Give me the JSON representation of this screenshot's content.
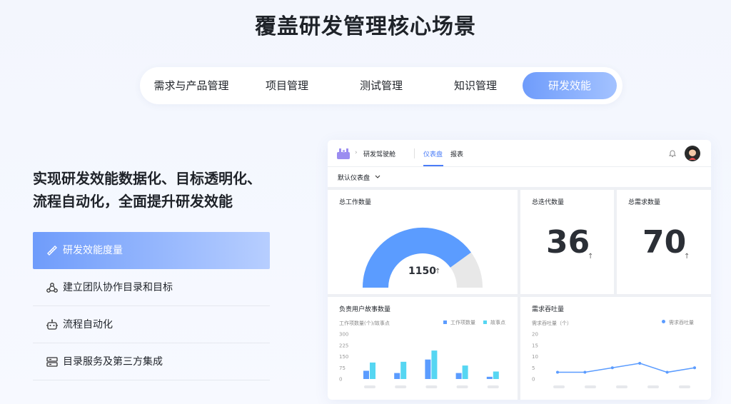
{
  "title": "覆盖研发管理核心场景",
  "tabs": [
    {
      "label": "需求与产品管理"
    },
    {
      "label": "项目管理"
    },
    {
      "label": "测试管理"
    },
    {
      "label": "知识管理"
    },
    {
      "label": "研发效能"
    }
  ],
  "headline": {
    "line1": "实现研发效能数据化、目标透明化、",
    "line2": "流程自动化，全面提升研发效能"
  },
  "features": [
    {
      "label": "研发效能度量",
      "icon": "ruler-icon"
    },
    {
      "label": "建立团队协作目录和目标",
      "icon": "team-icon"
    },
    {
      "label": "流程自动化",
      "icon": "robot-icon"
    },
    {
      "label": "目录服务及第三方集成",
      "icon": "server-icon"
    }
  ],
  "dashboard": {
    "breadcrumb": "研发驾驶舱",
    "tab_active": "仪表盘",
    "tab_other": "报表",
    "selector": "默认仪表盘",
    "card1": {
      "title": "总工作数量",
      "value": "1150",
      "gauge_fraction": 0.8
    },
    "card2": {
      "title": "总迭代数量",
      "value": "36"
    },
    "card3": {
      "title": "总需求数量",
      "value": "70"
    },
    "arrow": "↑",
    "colors": {
      "primary": "#5b9cff",
      "secondary": "#56d6f2",
      "gauge_bg": "#e8e8e8"
    }
  },
  "chart_data": [
    {
      "type": "bar",
      "title": "负责用户故事数量",
      "ylabel": "工作项数量(个)/故事点",
      "ylim": [
        0,
        300
      ],
      "yticks": [
        "300",
        "225",
        "150",
        "75",
        "0"
      ],
      "categories": [
        "",
        "",
        "",
        "",
        ""
      ],
      "series": [
        {
          "name": "工作项数量",
          "values": [
            55,
            40,
            130,
            40,
            15
          ]
        },
        {
          "name": "故事点",
          "values": [
            110,
            115,
            190,
            90,
            50
          ]
        }
      ]
    },
    {
      "type": "line",
      "title": "需求吞吐量",
      "ylabel": "需求吞吐量（个）",
      "ylim": [
        0,
        20
      ],
      "yticks": [
        "20",
        "15",
        "10",
        "5",
        "0"
      ],
      "categories": [
        "",
        "",
        "",
        "",
        "",
        ""
      ],
      "series": [
        {
          "name": "需求吞吐量",
          "values": [
            3,
            3,
            5,
            7,
            3,
            5
          ]
        }
      ]
    }
  ]
}
